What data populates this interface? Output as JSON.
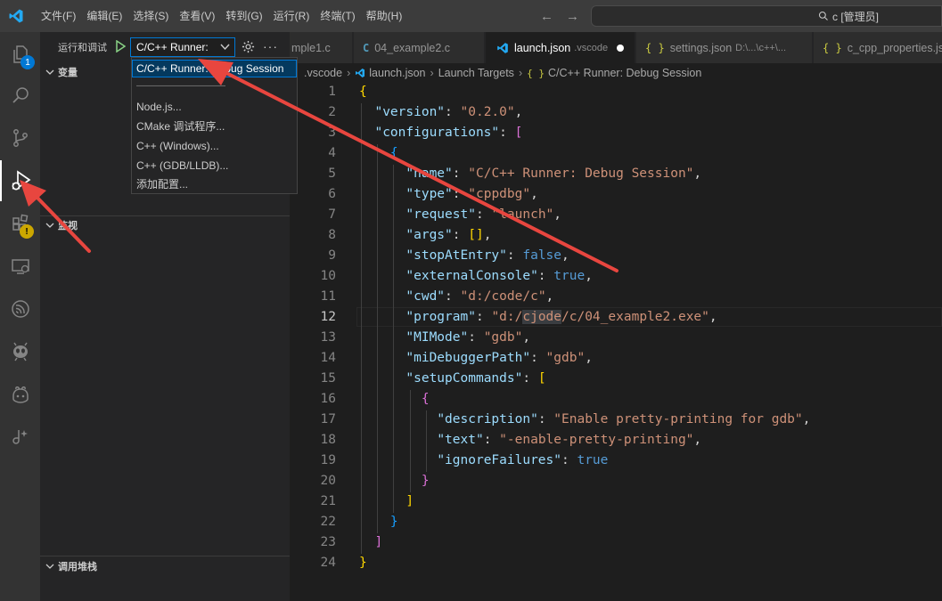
{
  "titlebar": {
    "menus": [
      "文件(F)",
      "编辑(E)",
      "选择(S)",
      "查看(V)",
      "转到(G)",
      "运行(R)",
      "终端(T)",
      "帮助(H)"
    ],
    "search_text": "c [管理员]"
  },
  "activity": {
    "explorer_badge": "1",
    "extensions_badge": "!"
  },
  "sidebar": {
    "title": "运行和调试",
    "config_selected": "C/C++ Runner:",
    "sections": {
      "variables": "变量",
      "watch": "监视",
      "callstack": "调用堆栈"
    }
  },
  "dropdown": {
    "items": [
      "C/C++ Runner: Debug Session",
      "——————————",
      "Node.js...",
      "CMake 调试程序...",
      "C++ (Windows)...",
      "C++ (GDB/LLDB)...",
      "添加配置..."
    ]
  },
  "tabs": [
    {
      "label": "mple1.c",
      "desc": "",
      "icon": "c-file-icon"
    },
    {
      "label": "04_example2.c",
      "desc": "",
      "icon": "c-file-icon"
    },
    {
      "label": "launch.json",
      "desc": ".vscode",
      "icon": "vscode-icon",
      "active": true,
      "modified": true
    },
    {
      "label": "settings.json",
      "desc": "D:\\...\\c++\\...",
      "icon": "json-icon"
    },
    {
      "label": "c_cpp_properties.json",
      "desc": "",
      "icon": "json-icon"
    }
  ],
  "breadcrumb": [
    ".vscode",
    "launch.json",
    "Launch Targets",
    "C/C++ Runner: Debug Session"
  ],
  "editor": {
    "current_line": 12,
    "line_numbers": [
      "1",
      "2",
      "3",
      "4",
      "5",
      "6",
      "7",
      "8",
      "9",
      "10",
      "11",
      "12",
      "13",
      "14",
      "15",
      "16",
      "17",
      "18",
      "19",
      "20",
      "21",
      "22",
      "23",
      "24"
    ],
    "keys": {
      "version": "\"version\"",
      "configurations": "\"configurations\"",
      "name": "\"name\"",
      "type": "\"type\"",
      "request": "\"request\"",
      "args": "\"args\"",
      "stopAtEntry": "\"stopAtEntry\"",
      "externalConsole": "\"externalConsole\"",
      "cwd": "\"cwd\"",
      "program": "\"program\"",
      "MIMode": "\"MIMode\"",
      "miDebuggerPath": "\"miDebuggerPath\"",
      "setupCommands": "\"setupCommands\"",
      "description": "\"description\"",
      "text": "\"text\"",
      "ignoreFailures": "\"ignoreFailures\""
    },
    "values": {
      "version": "\"0.2.0\"",
      "name": "\"C/C++ Runner: Debug Session\"",
      "type": "\"cppdbg\"",
      "request": "\"launch\"",
      "stopAtEntry": "false",
      "externalConsole": "true",
      "cwd": "\"d:/code/c\"",
      "program_pre": "\"d:/",
      "program_hl": "cjode",
      "program_post": "/c/04_example2.exe\"",
      "MIMode": "\"gdb\"",
      "miDebuggerPath": "\"gdb\"",
      "description": "\"Enable pretty-printing for gdb\"",
      "text": "\"-enable-pretty-printing\"",
      "ignoreFailures": "true"
    }
  },
  "colors": {
    "accent": "#0078d4",
    "annotation_arrow": "#e8463f"
  }
}
